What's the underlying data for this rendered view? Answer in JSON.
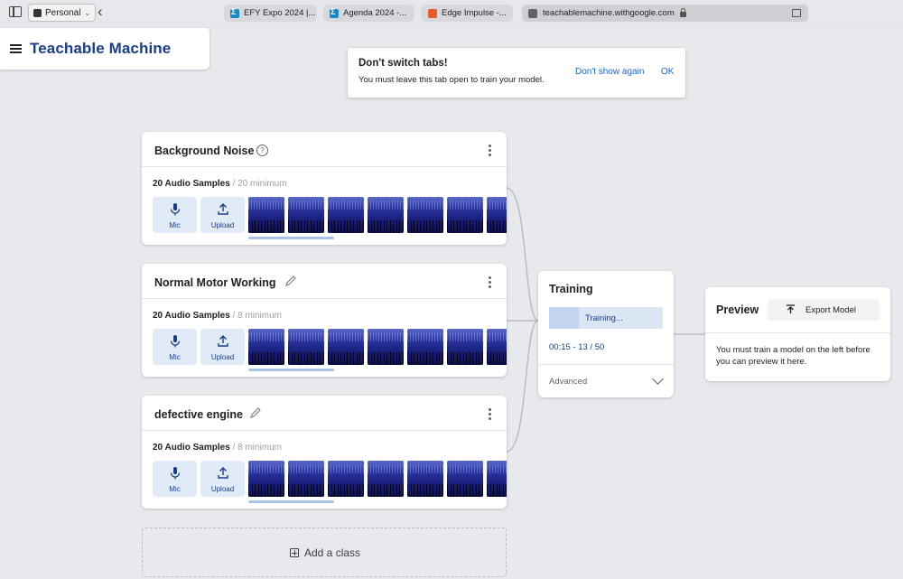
{
  "browser": {
    "profile_label": "Personal",
    "tabs": [
      {
        "title": "EFY Expo 2024 |...",
        "favicon": "sigma-icon"
      },
      {
        "title": "Agenda 2024 -...",
        "favicon": "sigma-icon"
      },
      {
        "title": "Edge Impulse -...",
        "favicon": "edge-impulse-icon"
      }
    ],
    "address": "teachablemachine.withgoogle.com"
  },
  "app": {
    "title": "Teachable Machine"
  },
  "toast": {
    "title": "Don't switch tabs!",
    "body": "You must leave this tab open to train your model.",
    "dismiss_label": "Don't show again",
    "ok_label": "OK"
  },
  "classes": [
    {
      "name": "Background Noise",
      "samples_label": "20 Audio Samples",
      "minimum_label": " / 20 minimum",
      "mic_label": "Mic",
      "upload_label": "Upload",
      "thumbnail_count": 7
    },
    {
      "name": "Normal Motor Working",
      "samples_label": "20 Audio Samples",
      "minimum_label": " / 8 minimum",
      "mic_label": "Mic",
      "upload_label": "Upload",
      "thumbnail_count": 7
    },
    {
      "name": "defective engine",
      "samples_label": "20 Audio Samples",
      "minimum_label": " / 8 minimum",
      "mic_label": "Mic",
      "upload_label": "Upload",
      "thumbnail_count": 7
    }
  ],
  "add_class_label": "Add a class",
  "training": {
    "title": "Training",
    "button_label": "Training...",
    "progress_fraction": 0.26,
    "status": "00:15 - 13 / 50",
    "advanced_label": "Advanced"
  },
  "preview": {
    "title": "Preview",
    "export_label": "Export Model",
    "message": "You must train a model on the left before you can preview it here."
  },
  "colors": {
    "brand": "#1a3d8a",
    "accent_blue": "#1967d2",
    "button_bg": "#e1eaf7"
  }
}
